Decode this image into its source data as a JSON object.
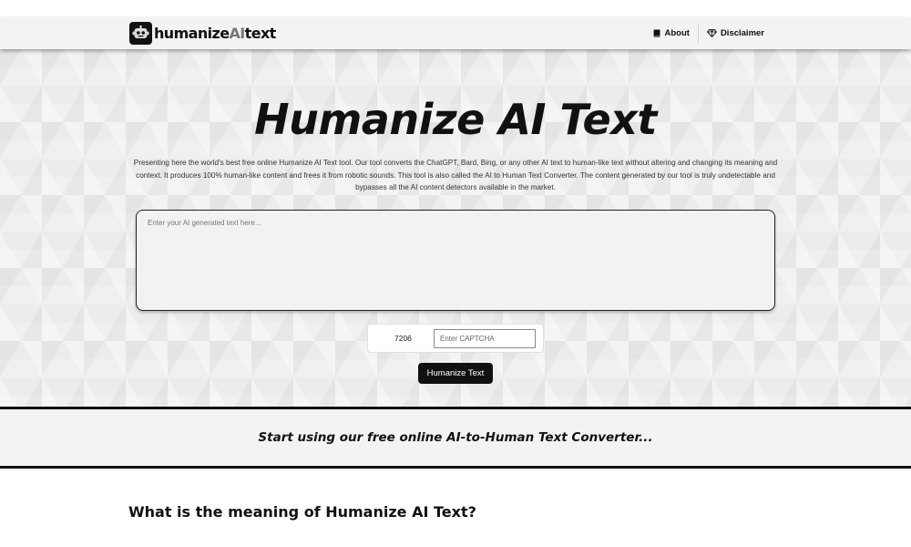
{
  "brand": {
    "name_prefix": "humanize",
    "name_accent": "AI",
    "name_suffix": "text"
  },
  "nav": {
    "about_label": "About",
    "disclaimer_label": "Disclaimer"
  },
  "hero": {
    "title": "Humanize AI Text",
    "description": "Presenting here the world's best free online Humanize AI Text tool. Our tool converts the ChatGPT, Bard, Bing, or any other AI text to human-like text without altering and changing its meaning and context. It produces 100% human-like content and frees it from robotic sounds. This tool is also called the AI to Human Text Converter. The content generated by our tool is truly undetectable and bypasses all the AI content detectors available in the market."
  },
  "input": {
    "placeholder": "Enter your AI generated text here..."
  },
  "captcha": {
    "code": "7206",
    "placeholder": "Enter CAPTCHA"
  },
  "submit_label": "Humanize Text",
  "banner_text": "Start using our free online AI-to-Human Text Converter...",
  "section_heading": "What is the meaning of Humanize AI Text?",
  "colors": {
    "primary": "#111111",
    "background": "#ececec",
    "accent_text": "#777777"
  },
  "icons": {
    "logo": "robot-icon",
    "about": "book-icon",
    "disclaimer": "diamond-icon"
  }
}
